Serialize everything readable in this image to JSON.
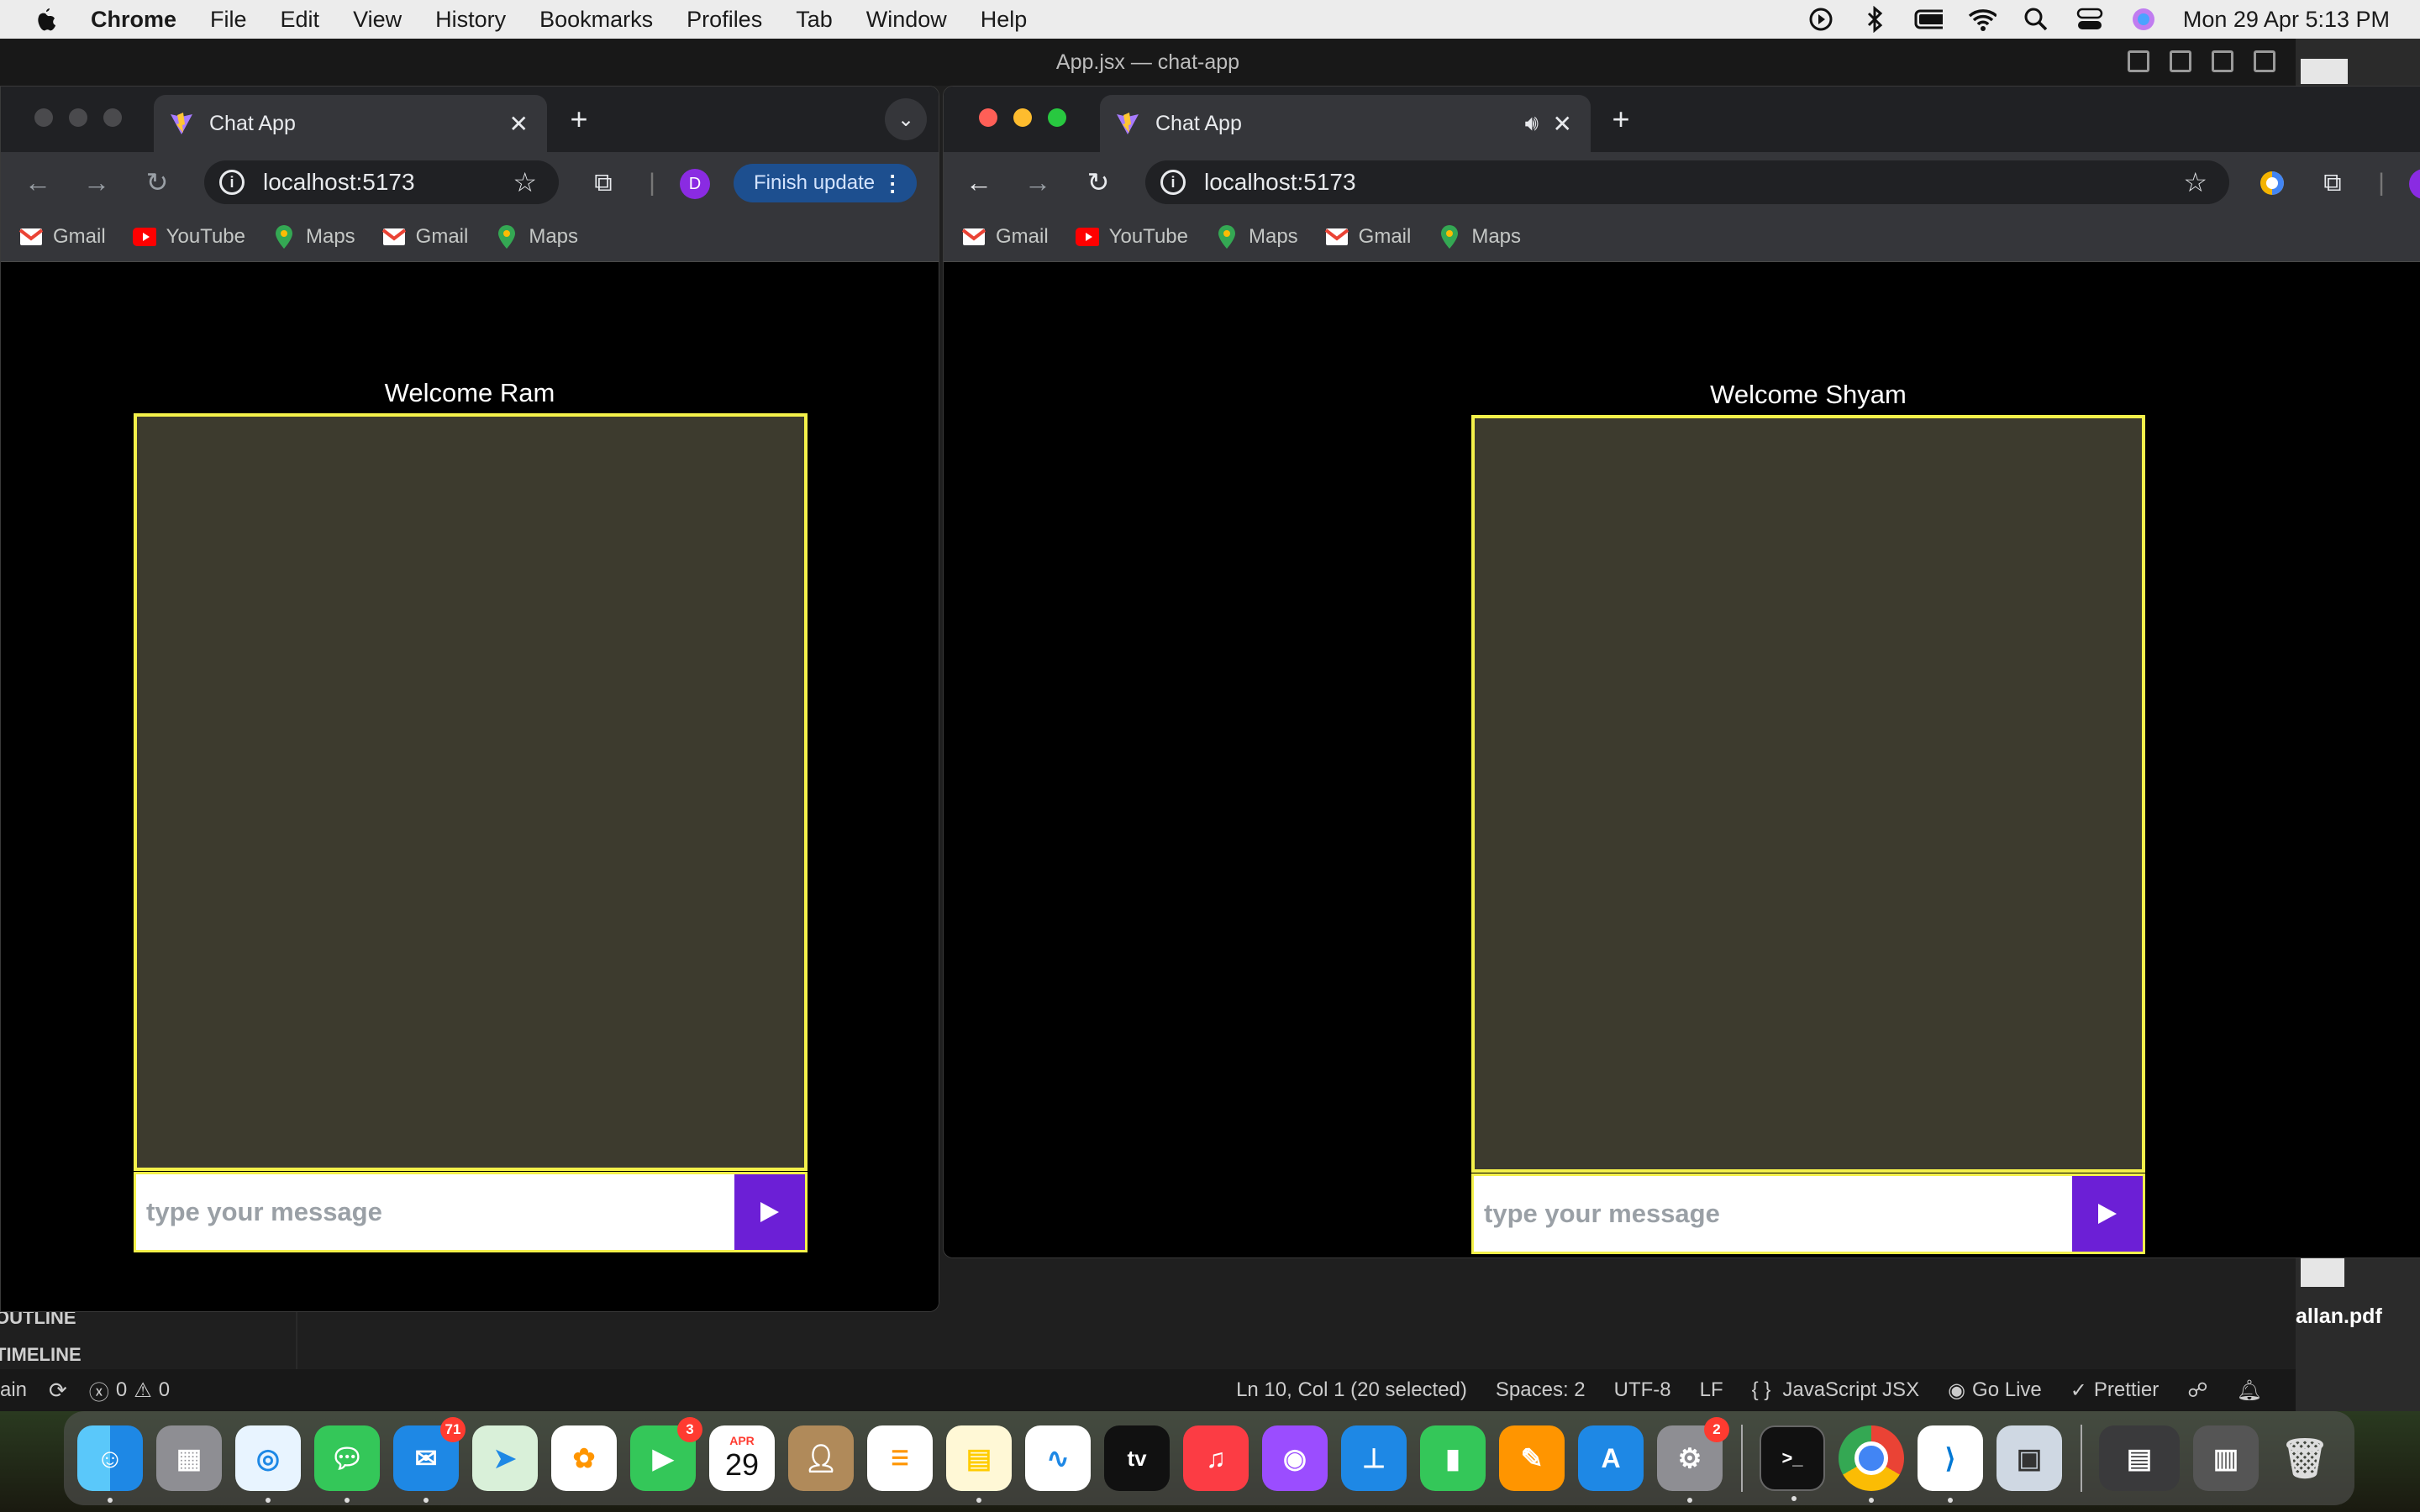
{
  "menubar": {
    "app_name": "Chrome",
    "items": [
      "File",
      "Edit",
      "View",
      "History",
      "Bookmarks",
      "Profiles",
      "Tab",
      "Window",
      "Help"
    ],
    "datetime": "Mon 29 Apr  5:13 PM"
  },
  "vscode": {
    "title": "App.jsx — chat-app",
    "outline_label": "OUTLINE",
    "timeline_label": "TIMELINE",
    "status": {
      "branch_fragment": "ain",
      "problems": "0",
      "warnings": "0",
      "cursor": "Ln 10, Col 1 (20 selected)",
      "spaces": "Spaces: 2",
      "encoding": "UTF-8",
      "eol": "LF",
      "language": "JavaScript JSX",
      "golive": "Go Live",
      "prettier": "Prettier"
    },
    "desktop_file": "allan.pdf"
  },
  "chrome_left": {
    "tab_title": "Chat App",
    "url": "localhost:5173",
    "profile_initial": "D",
    "finish_update": "Finish update",
    "bookmarks": [
      "Gmail",
      "YouTube",
      "Maps",
      "Gmail",
      "Maps"
    ],
    "page": {
      "welcome": "Welcome Ram",
      "placeholder": "type your message"
    }
  },
  "chrome_right": {
    "tab_title": "Chat App",
    "url": "localhost:5173",
    "bookmarks": [
      "Gmail",
      "YouTube",
      "Maps",
      "Gmail",
      "Maps"
    ],
    "page": {
      "welcome": "Welcome Shyam",
      "placeholder": "type your message"
    }
  },
  "dock": {
    "mail_badge": "71",
    "facetime_badge": "3",
    "calendar_month": "APR",
    "calendar_day": "29",
    "settings_badge": "2",
    "appletv_label": "tv"
  },
  "colors": {
    "chat_border": "#f4f14a",
    "chat_bg": "#3d3b2e",
    "send_button": "#6c1fd6"
  }
}
